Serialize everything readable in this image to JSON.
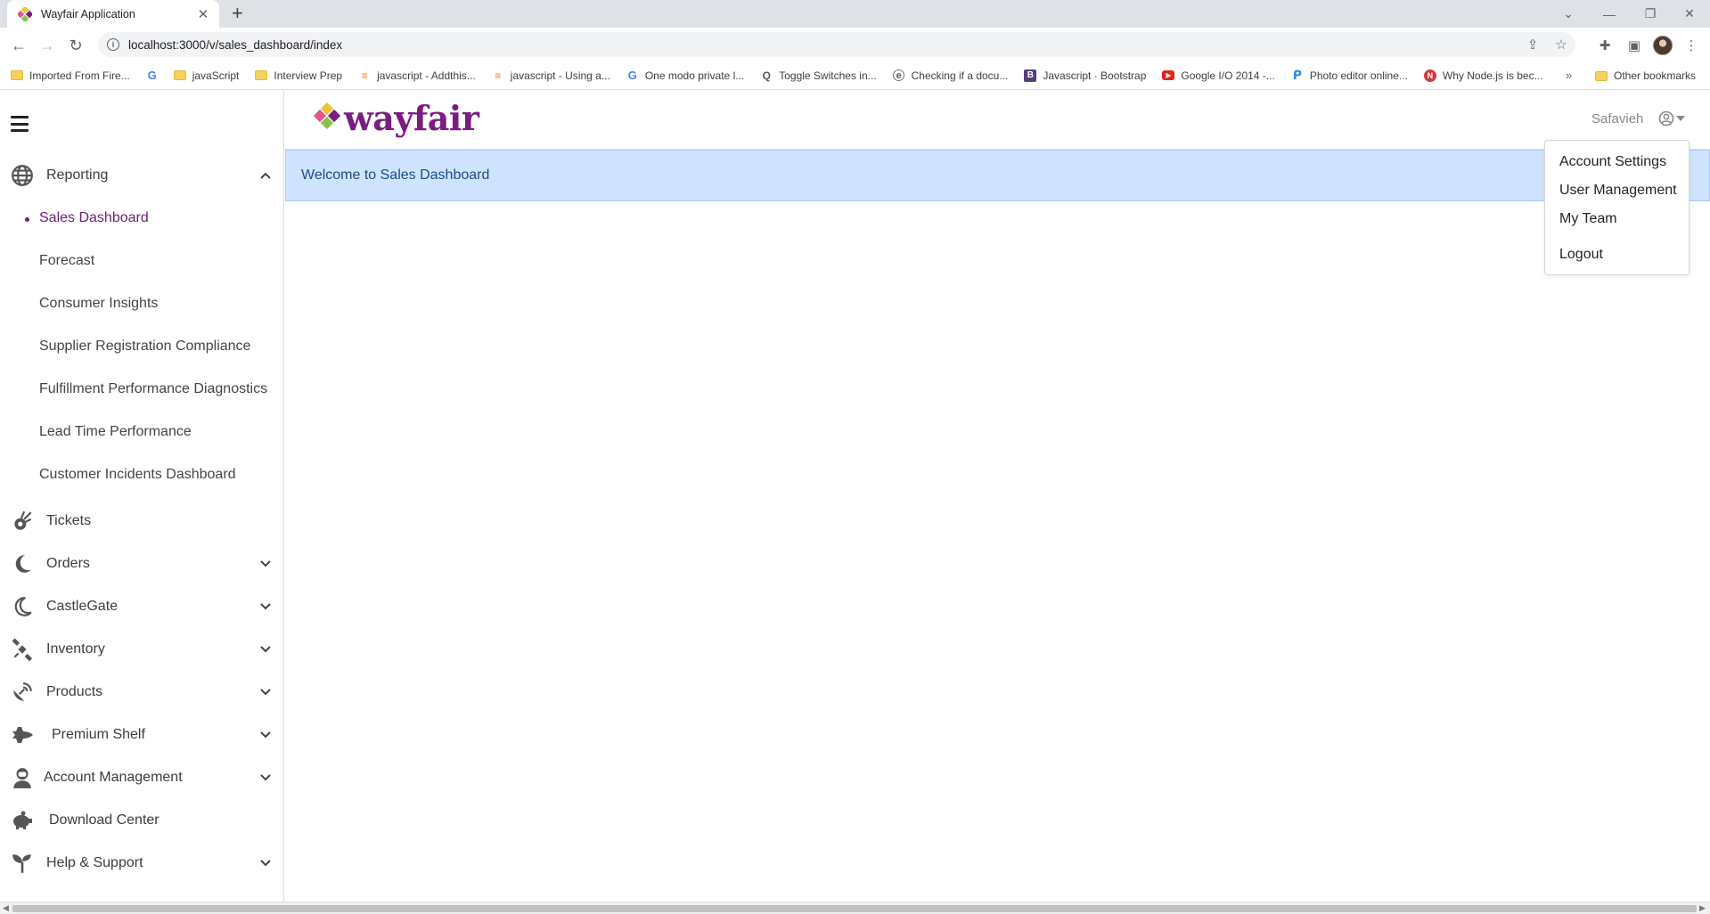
{
  "browser": {
    "tab_title": "Wayfair Application",
    "tab_close": "✕",
    "new_tab": "+",
    "url": "localhost:3000/v/sales_dashboard/index",
    "bookmarks": [
      {
        "label": "Imported From Fire...",
        "icon": "folder"
      },
      {
        "label": "",
        "icon": "google"
      },
      {
        "label": "javaScript",
        "icon": "folder"
      },
      {
        "label": "Interview Prep",
        "icon": "folder"
      },
      {
        "label": "javascript - Addthis...",
        "icon": "stackoverflow"
      },
      {
        "label": "javascript - Using a...",
        "icon": "stackoverflow"
      },
      {
        "label": "One modo private l...",
        "icon": "google"
      },
      {
        "label": "Toggle Switches in...",
        "icon": "q"
      },
      {
        "label": "Checking if a docu...",
        "icon": "e"
      },
      {
        "label": "Javascript · Bootstrap",
        "icon": "bootstrap"
      },
      {
        "label": "Google I/O 2014 -...",
        "icon": "youtube"
      },
      {
        "label": "Photo editor online...",
        "icon": "pixlr"
      },
      {
        "label": "Why Node.js is bec...",
        "icon": "node"
      }
    ],
    "bookmarks_more": "»",
    "other_bookmarks": "Other bookmarks"
  },
  "header": {
    "logo_text": "wayfair",
    "user_name": "Safavieh"
  },
  "user_menu": {
    "items": [
      "Account Settings",
      "User Management",
      "My Team",
      "Logout"
    ]
  },
  "banner": {
    "text": "Welcome to Sales Dashboard"
  },
  "sidebar": {
    "reporting": {
      "label": "Reporting",
      "icon": "globe-icon",
      "subitems": [
        "Sales Dashboard",
        "Forecast",
        "Consumer Insights",
        "Supplier Registration Compliance",
        "Fulfillment Performance Diagnostics",
        "Lead Time Performance",
        "Customer Incidents Dashboard"
      ]
    },
    "items": [
      {
        "label": "Tickets",
        "icon": "comet-icon",
        "expandable": false
      },
      {
        "label": "Orders",
        "icon": "moon-icon",
        "expandable": true
      },
      {
        "label": "CastleGate",
        "icon": "crescent-icon",
        "expandable": true
      },
      {
        "label": "Inventory",
        "icon": "satellite-icon",
        "expandable": true
      },
      {
        "label": "Products",
        "icon": "satellite-dish-icon",
        "expandable": true
      },
      {
        "label": "Premium Shelf",
        "icon": "space-shuttle-icon",
        "expandable": true
      },
      {
        "label": "Account Management",
        "icon": "user-astronaut-icon",
        "expandable": true
      },
      {
        "label": "Download Center",
        "icon": "piggy-bank-icon",
        "expandable": false
      },
      {
        "label": "Help & Support",
        "icon": "seedling-icon",
        "expandable": true
      }
    ]
  },
  "colors": {
    "brand_purple": "#7b1c81",
    "active_item": "#6d2079",
    "banner_bg": "#cfe3fe",
    "banner_text": "#1d4a84"
  }
}
